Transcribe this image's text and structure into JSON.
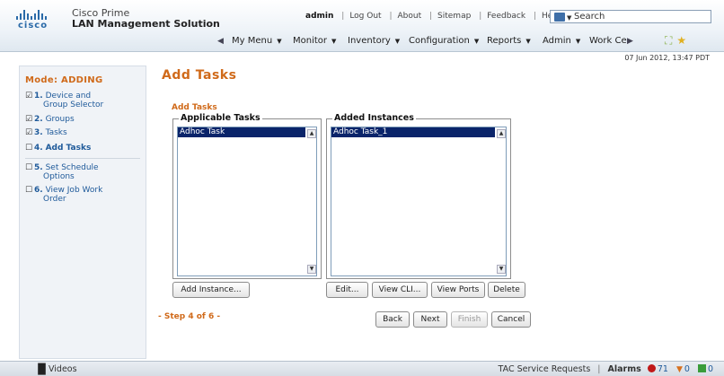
{
  "header": {
    "logo_text": "cisco",
    "product_line1": "Cisco Prime",
    "product_line2": "LAN Management Solution",
    "user": "admin",
    "links": [
      "Log Out",
      "About",
      "Sitemap",
      "Feedback",
      "Help"
    ],
    "search_placeholder": "Search",
    "menu": [
      "My Menu",
      "Monitor",
      "Inventory",
      "Configuration",
      "Reports",
      "Admin",
      "Work Ce"
    ],
    "timestamp": "07 Jun 2012, 13:47 PDT"
  },
  "sidebar": {
    "mode": "Mode: ADDING",
    "steps": [
      {
        "marker": "☑",
        "num": "1.",
        "label": "Device and",
        "sub": "Group Selector"
      },
      {
        "marker": "☑",
        "num": "2.",
        "label": "Groups",
        "sub": ""
      },
      {
        "marker": "☑",
        "num": "3.",
        "label": "Tasks",
        "sub": ""
      },
      {
        "marker": "☐",
        "num": "4.",
        "label": "Add Tasks",
        "sub": ""
      },
      {
        "marker": "☐",
        "num": "5.",
        "label": "Set Schedule",
        "sub": "Options"
      },
      {
        "marker": "☐",
        "num": "6.",
        "label": "View Job Work",
        "sub": "Order"
      }
    ]
  },
  "main": {
    "title": "Add Tasks",
    "section_label": "Add Tasks",
    "applicable": {
      "legend": "Applicable Tasks",
      "items": [
        "Adhoc Task"
      ]
    },
    "added": {
      "legend": "Added Instances",
      "items": [
        "Adhoc Task_1"
      ]
    },
    "buttons": {
      "add_instance": "Add Instance...",
      "edit": "Edit...",
      "view_cli": "View CLI...",
      "view_ports": "View Ports",
      "delete": "Delete"
    },
    "step_of": "- Step 4 of 6 -",
    "nav": {
      "back": "Back",
      "next": "Next",
      "finish": "Finish",
      "cancel": "Cancel"
    }
  },
  "footer": {
    "videos": "Videos",
    "tac": "TAC Service Requests",
    "alarms_label": "Alarms",
    "critical": "71",
    "major": "0",
    "ok": "0"
  }
}
